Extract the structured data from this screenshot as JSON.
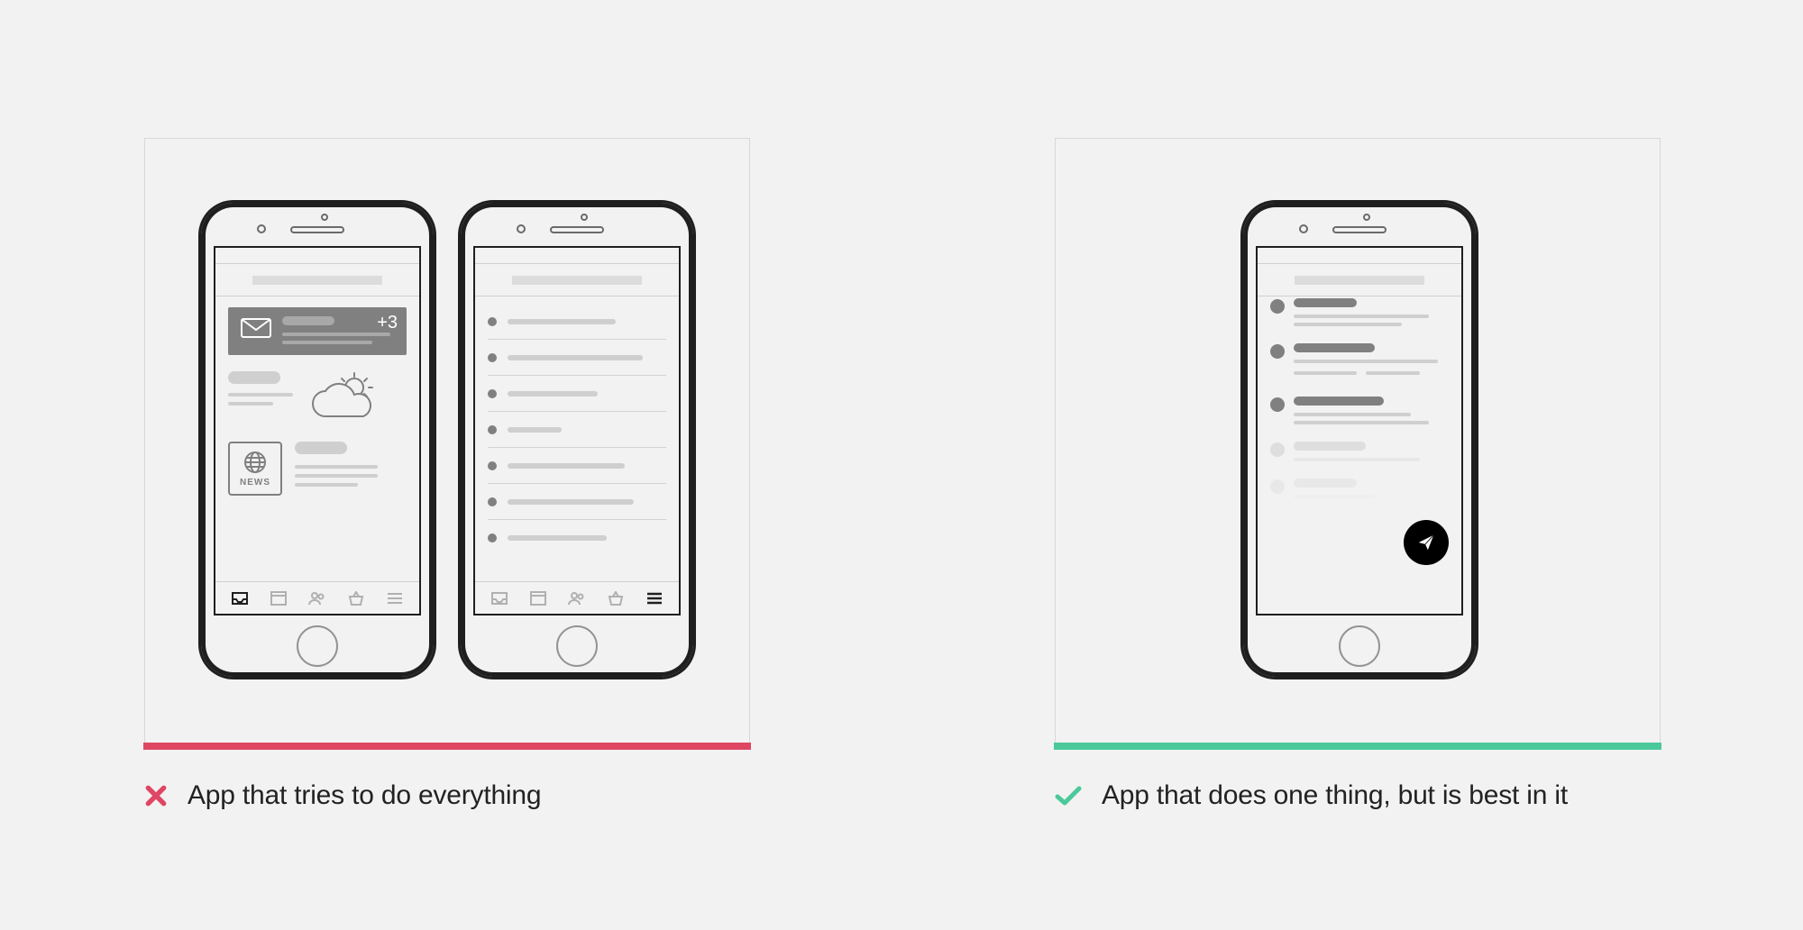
{
  "left": {
    "caption": "App that tries to do everything",
    "underline_color": "#df4664",
    "mail_badge": "+3",
    "news_label": "NEWS"
  },
  "right": {
    "caption": "App that does one thing, but is best in it",
    "underline_color": "#4bc99b"
  }
}
